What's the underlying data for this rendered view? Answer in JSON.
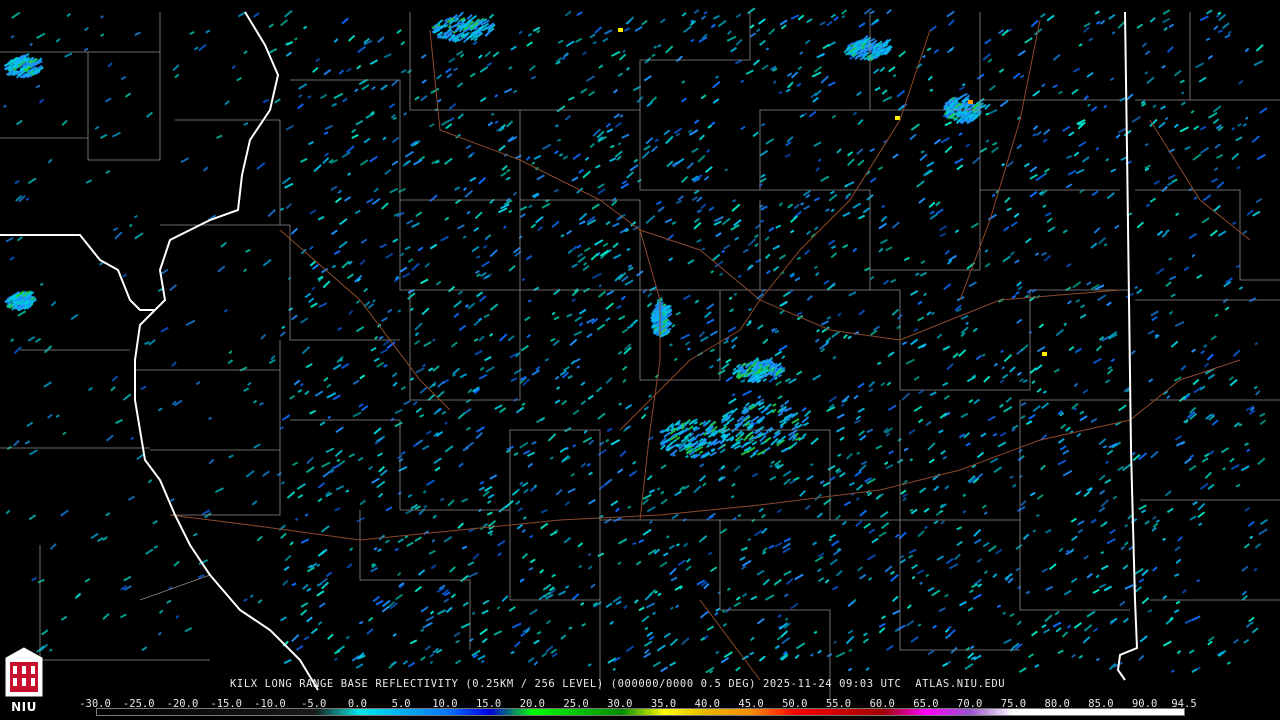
{
  "product": {
    "caption": "KILX LONG RANGE BASE REFLECTIVITY (0.25KM / 256 LEVEL) (000000/0000 0.5 DEG) 2025-11-24 09:03 UTC  ATLAS.NIU.EDU"
  },
  "color_scale": {
    "labels": [
      "-30.0",
      "-25.0",
      "-20.0",
      "-15.0",
      "-10.0",
      "-5.0",
      "0.0",
      "5.0",
      "10.0",
      "15.0",
      "20.0",
      "25.0",
      "30.0",
      "35.0",
      "40.0",
      "45.0",
      "50.0",
      "55.0",
      "60.0",
      "65.0",
      "70.0",
      "75.0",
      "80.0",
      "85.0",
      "90.0",
      "94.5"
    ],
    "stops": [
      {
        "dbz": -30,
        "color": "#000000"
      },
      {
        "dbz": -5,
        "color": "#1a1a1a"
      },
      {
        "dbz": 0,
        "color": "#00e8e8"
      },
      {
        "dbz": 10,
        "color": "#0078ff"
      },
      {
        "dbz": 15,
        "color": "#0000e0"
      },
      {
        "dbz": 20,
        "color": "#00ff00"
      },
      {
        "dbz": 30,
        "color": "#008c00"
      },
      {
        "dbz": 35,
        "color": "#ffff00"
      },
      {
        "dbz": 40,
        "color": "#e6b400"
      },
      {
        "dbz": 45,
        "color": "#ff8c00"
      },
      {
        "dbz": 50,
        "color": "#ff0000"
      },
      {
        "dbz": 60,
        "color": "#a00000"
      },
      {
        "dbz": 65,
        "color": "#ff00ff"
      },
      {
        "dbz": 70,
        "color": "#9955cc"
      },
      {
        "dbz": 75,
        "color": "#ffffff"
      },
      {
        "dbz": 94.5,
        "color": "#ffffff"
      }
    ]
  },
  "colors": {
    "background": "#000000",
    "county_lines": "#8a8a8a",
    "state_lines": "#ffffff",
    "highways": "#8b4a2a"
  },
  "logo": {
    "text": "NIU",
    "icon": "niu-logo-icon"
  }
}
